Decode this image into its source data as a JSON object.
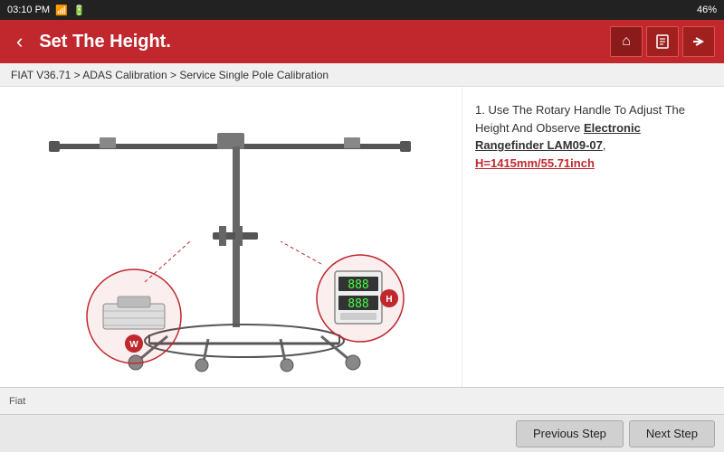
{
  "status_bar": {
    "time": "03:10 PM",
    "signal_icon": "📶",
    "battery_icon": "🔋",
    "battery_percent": "46%"
  },
  "header": {
    "back_icon": "‹",
    "title": "Set The Height.",
    "home_icon": "⌂",
    "doc_icon": "≡",
    "share_icon": "→"
  },
  "breadcrumb": {
    "text": "FIAT V36.71 > ADAS Calibration > Service Single Pole Calibration"
  },
  "instructions": {
    "step": "1. Use The Rotary Handle To Adjust The Height And Observe ",
    "rangefinder": "Electronic Rangefinder LAM09-07",
    "separator": ", ",
    "height": "H=1415mm/55.71inch"
  },
  "footer": {
    "brand": "Fiat"
  },
  "navigation": {
    "previous_label": "Previous Step",
    "next_label": "Next Step"
  }
}
